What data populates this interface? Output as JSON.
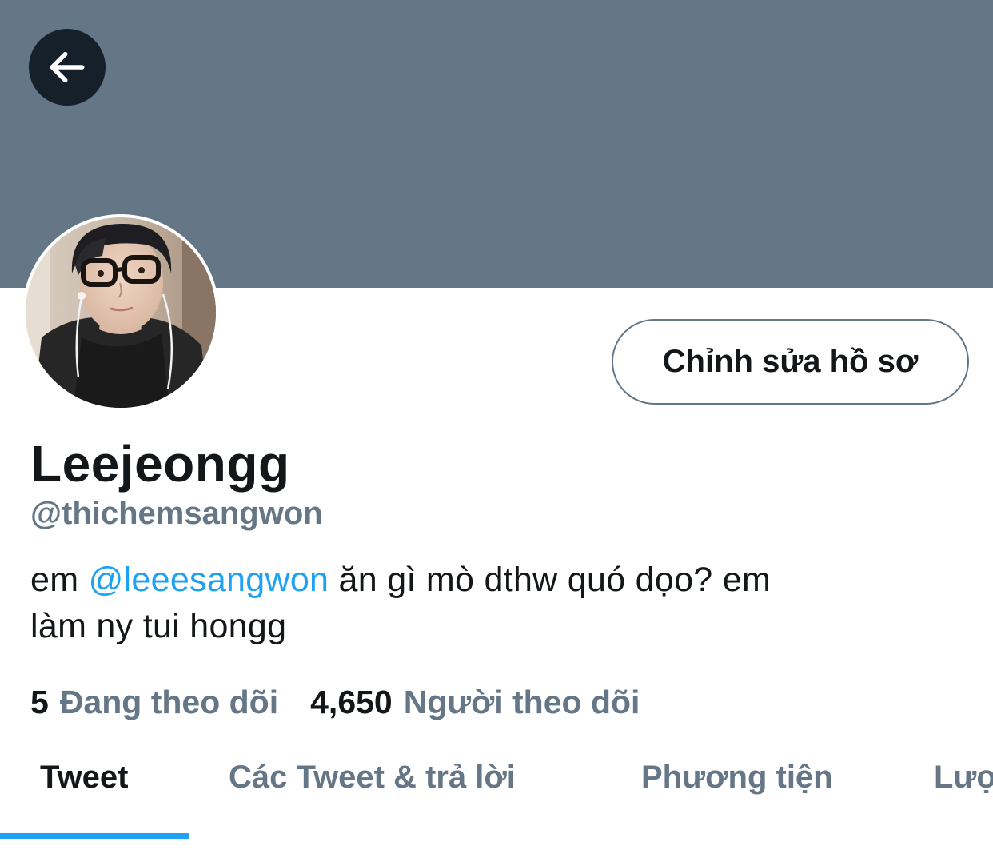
{
  "header": {
    "back_icon": "arrow-left-icon"
  },
  "profile": {
    "avatar": "avatar-photo",
    "edit_button_label": "Chỉnh sửa hồ sơ",
    "display_name": "Leejeongg",
    "handle": "@thichemsangwon",
    "bio": {
      "prefix": "em ",
      "mention": "@leeesangwon",
      "line1_rest": " ăn gì mò dthw quó dọo? em",
      "line2": "làm ny tui hongg"
    },
    "stats": {
      "following_count": "5",
      "following_label": "Đang theo dõi",
      "followers_count": "4,650",
      "followers_label": "Người theo dõi"
    }
  },
  "tabs": [
    {
      "label": "Tweet",
      "active": true
    },
    {
      "label": "Các Tweet & trả lời",
      "active": false
    },
    {
      "label": "Phương tiện",
      "active": false
    },
    {
      "label": "Lượt thích",
      "active": false
    }
  ],
  "colors": {
    "banner": "#657786",
    "accent": "#1da1f2",
    "text_primary": "#14171a",
    "text_secondary": "#657786"
  }
}
